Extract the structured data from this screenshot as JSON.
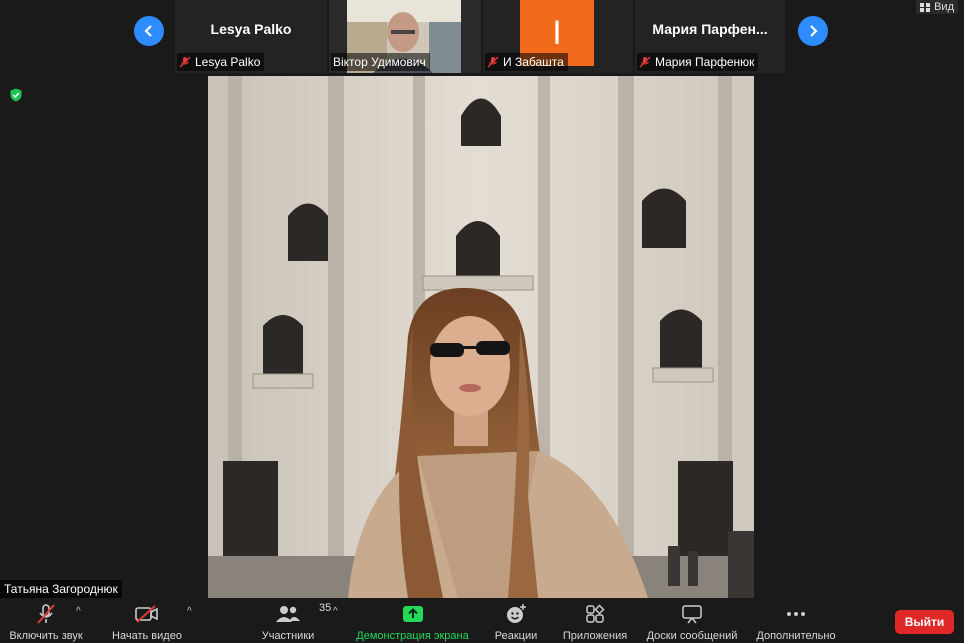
{
  "filmstrip": {
    "participants": [
      {
        "big_name": "Lesya Palko",
        "label": "Lesya Palko",
        "muted": true
      },
      {
        "big_name": "",
        "label": "Віктор Удимович",
        "muted": false
      },
      {
        "big_name": "",
        "label": "И Забашта",
        "muted": true,
        "avatar_letter": "І"
      },
      {
        "big_name": "Мария  Парфен...",
        "label": "Мария Парфенюк",
        "muted": true
      }
    ]
  },
  "view_label": "Вид",
  "active_speaker": "Татьяна Загороднюк",
  "toolbar": {
    "audio_label": "Включить звук",
    "video_label": "Начать видео",
    "participants_label": "Участники",
    "participants_count": "35",
    "share_label": "Демонстрация экрана",
    "reactions_label": "Реакции",
    "apps_label": "Приложения",
    "whiteboards_label": "Доски сообщений",
    "more_label": "Дополнительно",
    "leave_label": "Выйти"
  },
  "colors": {
    "accent": "#2d8cff",
    "share_green": "#23d959",
    "leave_red": "#e02828",
    "avatar_orange": "#f26b1d"
  }
}
